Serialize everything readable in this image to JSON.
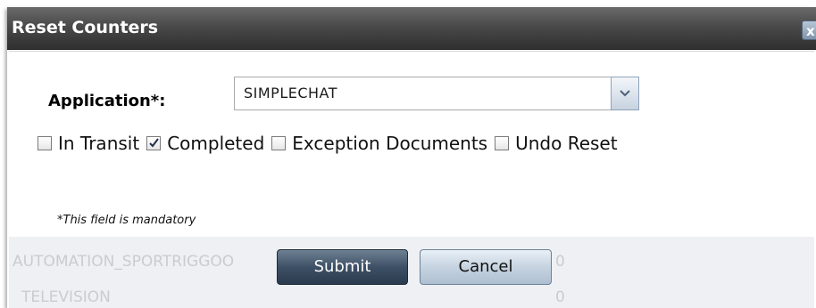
{
  "dialog": {
    "title": "Reset Counters",
    "close_glyph": "x",
    "application_label": "Application*:",
    "application_value": "SIMPLECHAT",
    "options": [
      {
        "label": "In Transit",
        "checked": false
      },
      {
        "label": "Completed",
        "checked": true
      },
      {
        "label": "Exception Documents",
        "checked": false
      },
      {
        "label": "Undo Reset",
        "checked": false
      }
    ],
    "mandatory_note": "*This field is mandatory",
    "submit_label": "Submit",
    "cancel_label": "Cancel"
  },
  "background": {
    "row1_text": "AUTOMATION_SPORTRIGGOO",
    "row1_right": "0",
    "row2_text": "TELEVISION",
    "row2_right": "0"
  },
  "colors": {
    "titlebar": "#4a4a4a",
    "submit": "#3e5065",
    "cancel": "#c6d3e0"
  }
}
